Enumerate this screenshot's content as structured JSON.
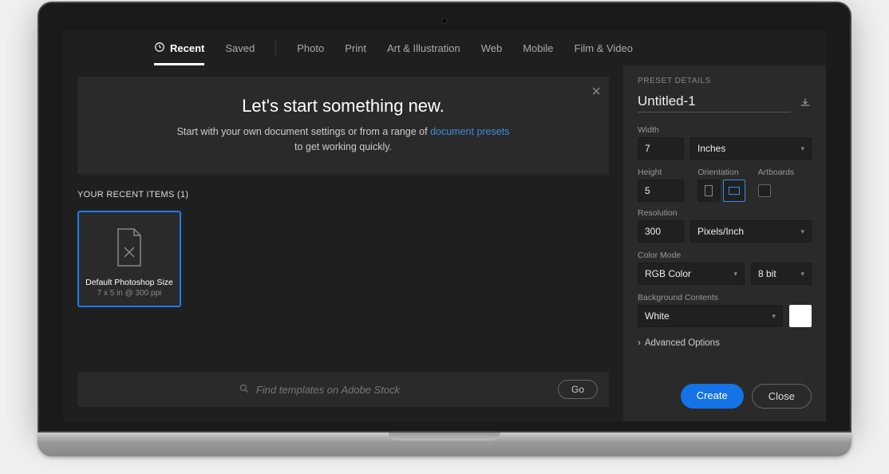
{
  "tabs": {
    "recent": "Recent",
    "saved": "Saved",
    "photo": "Photo",
    "print": "Print",
    "art": "Art & Illustration",
    "web": "Web",
    "mobile": "Mobile",
    "film": "Film & Video"
  },
  "hero": {
    "title": "Let's start something new.",
    "sub_prefix": "Start with your own document settings or from a range of ",
    "sub_link": "document presets",
    "sub_suffix": "to get working quickly."
  },
  "recent_section": {
    "label": "YOUR RECENT ITEMS  (1)",
    "card_title": "Default Photoshop Size",
    "card_sub": "7 x 5 in @ 300 ppi"
  },
  "search": {
    "placeholder": "Find templates on Adobe Stock",
    "go": "Go"
  },
  "preset": {
    "header": "PRESET DETAILS",
    "doc_name": "Untitled-1",
    "labels": {
      "width": "Width",
      "height": "Height",
      "orientation": "Orientation",
      "artboards": "Artboards",
      "resolution": "Resolution",
      "colormode": "Color Mode",
      "bgcontents": "Background Contents",
      "advanced": "Advanced Options"
    },
    "values": {
      "width": "7",
      "unit": "Inches",
      "height": "5",
      "resolution": "300",
      "res_unit": "Pixels/Inch",
      "colormode": "RGB Color",
      "bitdepth": "8 bit",
      "bg": "White"
    }
  },
  "buttons": {
    "create": "Create",
    "close": "Close"
  }
}
